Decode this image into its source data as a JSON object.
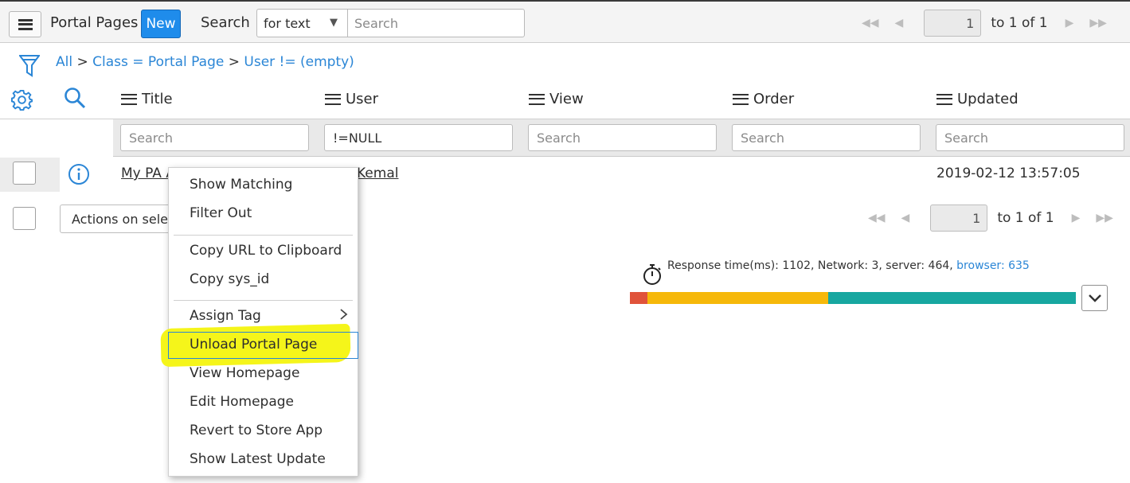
{
  "header": {
    "menu_icon": "hamburger-icon",
    "title": "Portal Pages",
    "new_label": "New",
    "search_label": "Search",
    "search_select_value": "for text",
    "search_placeholder": "Search",
    "pager": {
      "page": "1",
      "summary": "to 1 of 1"
    }
  },
  "breadcrumb": {
    "items": [
      "All",
      "Class = Portal Page",
      "User != (empty)"
    ],
    "separator": ">"
  },
  "columns": [
    "Title",
    "User",
    "View",
    "Order",
    "Updated"
  ],
  "filters": [
    {
      "placeholder": "Search",
      "value": ""
    },
    {
      "placeholder": "Search",
      "value": "!=NULL"
    },
    {
      "placeholder": "Search",
      "value": ""
    },
    {
      "placeholder": "Search",
      "value": ""
    },
    {
      "placeholder": "Search",
      "value": ""
    }
  ],
  "rows": [
    {
      "title": "My PA A",
      "user": "Kemal",
      "updated": "2019-02-12 13:57:05"
    }
  ],
  "actions_label": "Actions on selec",
  "footer_pager": {
    "page": "1",
    "summary": "to 1 of 1"
  },
  "response": {
    "text": "Response time(ms): 1102, Network: 3, server: 464, ",
    "browser": "browser: 635",
    "network_ms": 3,
    "server_ms": 464,
    "browser_ms": 635,
    "colors": {
      "network": "#e0533a",
      "server": "#f6b80a",
      "browser": "#17a7a0"
    }
  },
  "context_menu": {
    "items": [
      "Show Matching",
      "Filter Out",
      "Copy URL to Clipboard",
      "Copy sys_id",
      "Assign Tag",
      "Unload Portal Page",
      "View Homepage",
      "Edit Homepage",
      "Revert to Store App",
      "Show Latest Update"
    ],
    "highlighted": "Unload Portal Page",
    "highlight_color": "#f5f51a"
  },
  "colors": {
    "accent": "#1f8ceb",
    "link": "#2b86d6"
  }
}
